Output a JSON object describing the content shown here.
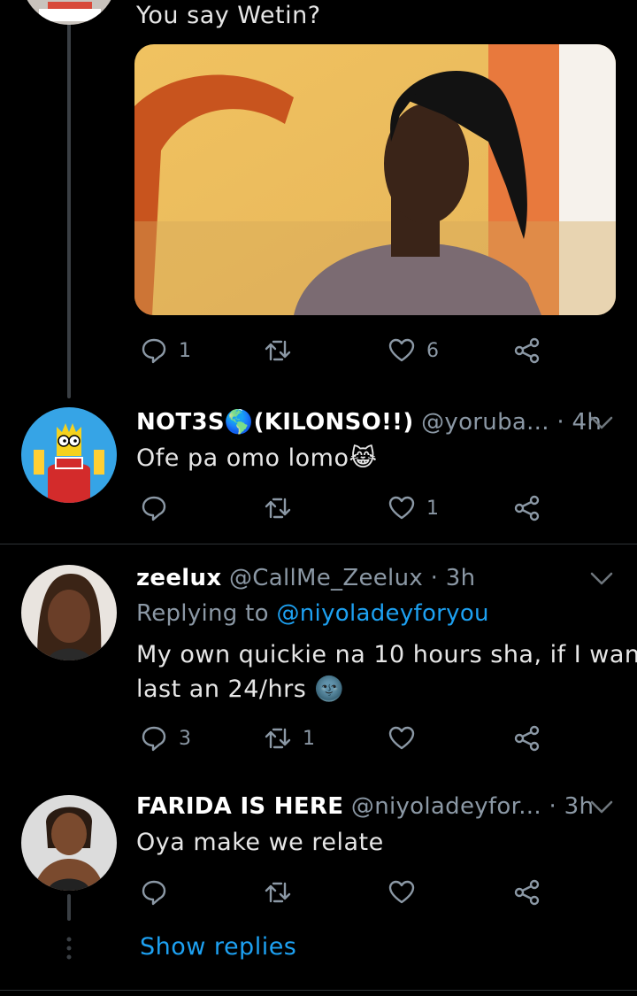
{
  "tweet_top": {
    "text": "You say Wetin?",
    "actions": {
      "reply_count": "1",
      "retweet_count": "",
      "like_count": "6"
    }
  },
  "reply_notes": {
    "display_name": "NOT3S🌎(KILONSO!!)",
    "handle": "@yoruba...",
    "time": "· 4h",
    "text": "Ofe pa omo lomo😹",
    "actions": {
      "reply_count": "",
      "retweet_count": "",
      "like_count": "1"
    }
  },
  "reply_zeelux": {
    "display_name": "zeelux",
    "handle": "@CallMe_Zeelux",
    "time": "· 3h",
    "replying_prefix": "Replying to",
    "replying_handle": "@niyoladeyforyou",
    "text_line1": "My own quickie na 10 hours sha, if I wan",
    "text_line2": "last an 24/hrs 🌚",
    "actions": {
      "reply_count": "3",
      "retweet_count": "1",
      "like_count": ""
    }
  },
  "reply_farida": {
    "display_name": "FARIDA IS HERE",
    "handle": "@niyoladeyfor...",
    "time": "· 3h",
    "text": "Oya make we relate",
    "actions": {
      "reply_count": "",
      "retweet_count": "",
      "like_count": ""
    }
  },
  "show_replies": {
    "label": "Show replies"
  },
  "colors": {
    "background": "#000000",
    "accent": "#1da1f2",
    "muted": "#8b98a5"
  }
}
